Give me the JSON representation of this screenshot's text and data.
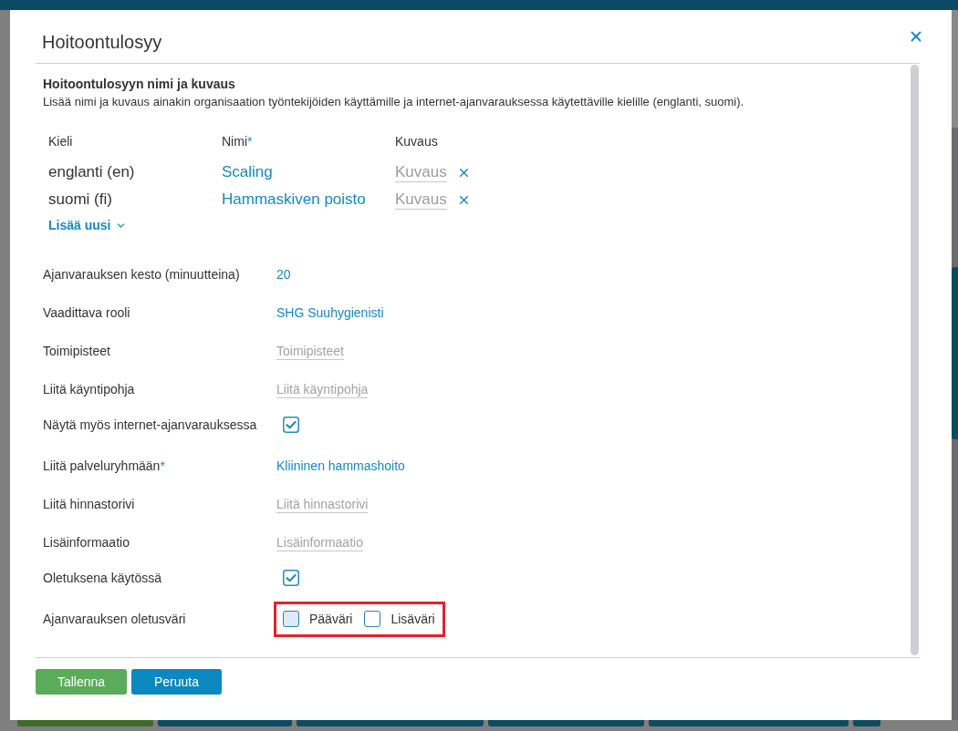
{
  "dialog": {
    "title": "Hoitoontulosyy"
  },
  "names_section": {
    "heading": "Hoitoontulosyyn nimi ja kuvaus",
    "description": "Lisää nimi ja kuvaus ainakin organisaation työntekijöiden käyttämille ja internet-ajanvarauksessa käytettäville kielille (englanti, suomi).",
    "columns": [
      {
        "label": "Kieli"
      },
      {
        "label": "Nimi",
        "required_mark": "*"
      },
      {
        "label": "Kuvaus"
      }
    ],
    "rows": [
      {
        "language": "englanti (en)",
        "name": "Scaling",
        "description_placeholder": "Kuvaus"
      },
      {
        "language": "suomi (fi)",
        "name": "Hammaskiven poisto",
        "description_placeholder": "Kuvaus"
      }
    ],
    "add_new": "Lisää uusi"
  },
  "fields": [
    {
      "kind": "value",
      "label": "Ajanvarauksen kesto (minuutteina)",
      "value": "20"
    },
    {
      "kind": "value",
      "label": "Vaadittava rooli",
      "value": "SHG Suuhygienisti"
    },
    {
      "kind": "input",
      "label": "Toimipisteet",
      "placeholder": "Toimipisteet"
    },
    {
      "kind": "input",
      "label": "Liitä käyntipohja",
      "placeholder": "Liitä käyntipohja"
    },
    {
      "kind": "checkbox",
      "label": "Näytä myös internet-ajanvarauksessa",
      "checked": true
    },
    {
      "kind": "value",
      "label": "Liitä palveluryhmään",
      "required_mark": "*",
      "value": "Kliininen hammashoito"
    },
    {
      "kind": "input",
      "label": "Liitä hinnastorivi",
      "placeholder": "Liitä hinnastorivi"
    },
    {
      "kind": "input",
      "label": "Lisäinformaatio",
      "placeholder": "Lisäinformaatio"
    },
    {
      "kind": "checkbox",
      "label": "Oletuksena käytössä",
      "checked": true
    },
    {
      "kind": "colors",
      "label": "Ajanvarauksen oletusväri",
      "highlighted": true,
      "options": [
        {
          "label": "Pääväri",
          "color": "#dcebf5"
        },
        {
          "label": "Lisäväri",
          "color": "#ffffff"
        }
      ]
    }
  ],
  "buttons": [
    {
      "label": "Tallenna",
      "kind": "primary"
    },
    {
      "label": "Peruuta",
      "kind": "secondary"
    }
  ]
}
